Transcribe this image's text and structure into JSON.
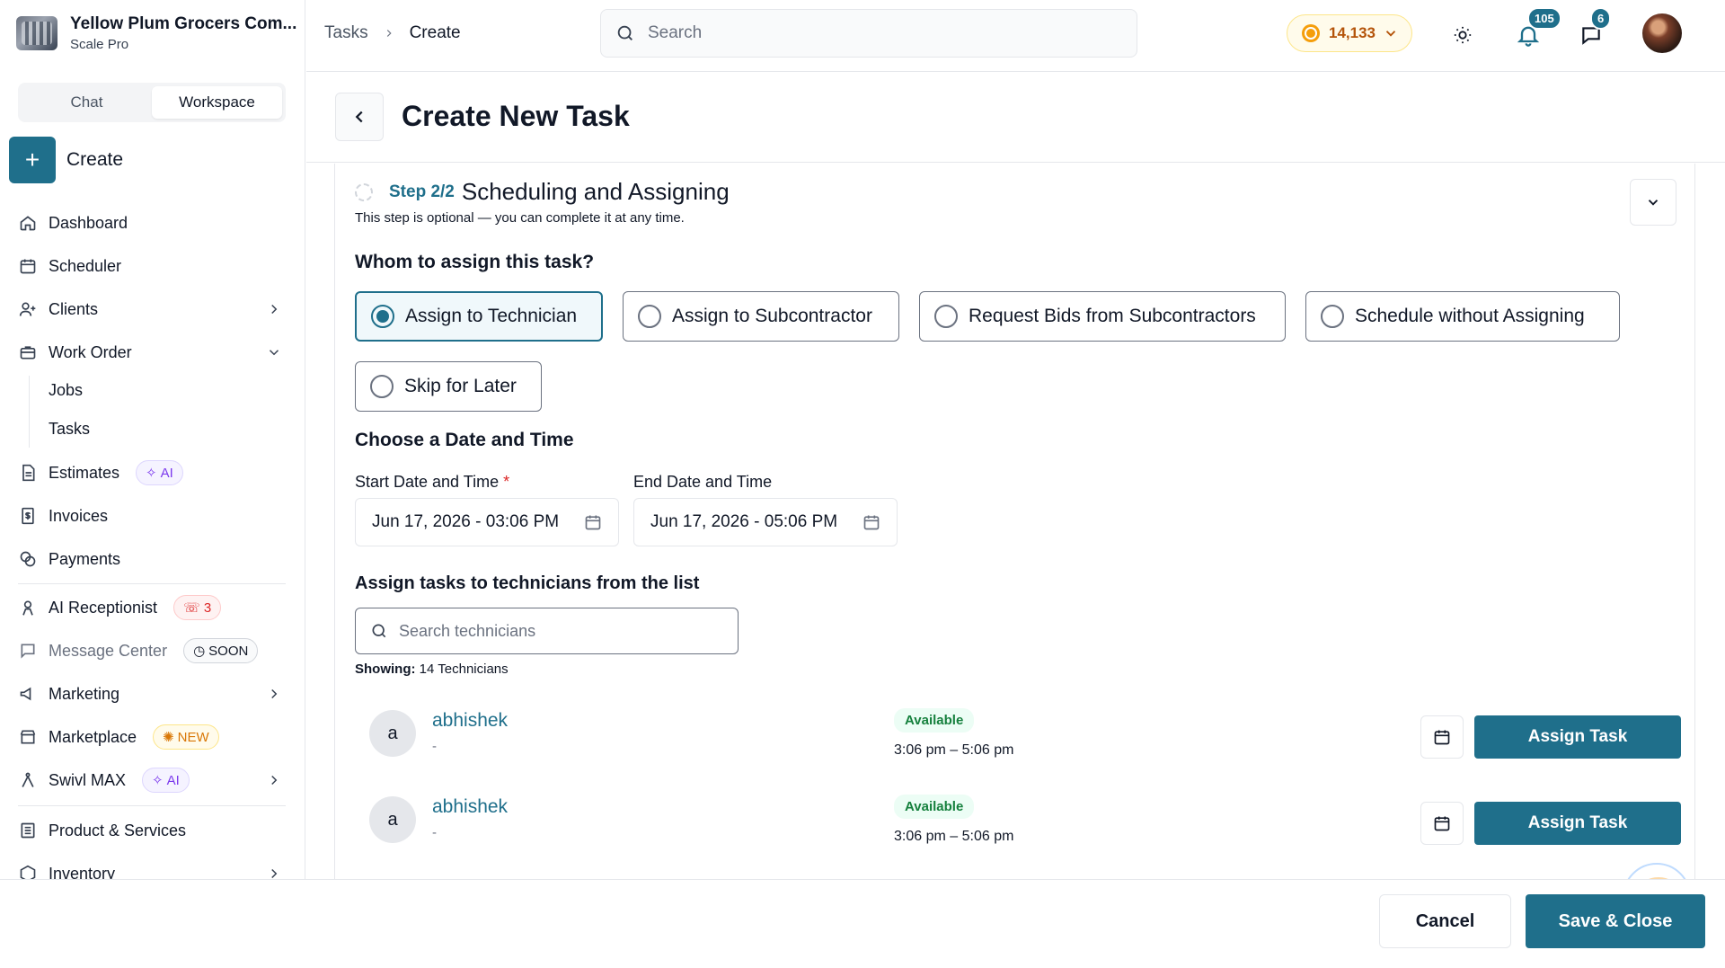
{
  "org": {
    "name": "Yellow Plum Grocers Com...",
    "plan": "Scale Pro"
  },
  "sidebar": {
    "segments": [
      {
        "label": "Chat"
      },
      {
        "label": "Workspace"
      }
    ],
    "active_segment": "Workspace",
    "create_label": "Create",
    "items": {
      "dashboard": "Dashboard",
      "scheduler": "Scheduler",
      "clients": "Clients",
      "work_order": "Work Order",
      "jobs": "Jobs",
      "tasks": "Tasks",
      "estimates": "Estimates",
      "estimates_badge": "AI",
      "invoices": "Invoices",
      "payments": "Payments",
      "ai_receptionist": "AI Receptionist",
      "ai_receptionist_badge": "3",
      "message_center": "Message Center",
      "message_center_badge": "SOON",
      "marketing": "Marketing",
      "marketplace": "Marketplace",
      "marketplace_badge": "NEW",
      "swivl_max": "Swivl MAX",
      "swivl_max_badge": "AI",
      "product_services": "Product & Services",
      "inventory": "Inventory"
    }
  },
  "topbar": {
    "breadcrumb": [
      "Tasks",
      "Create"
    ],
    "search_placeholder": "Search",
    "credits": "14,133",
    "notifications_count": "105",
    "messages_count": "6"
  },
  "page": {
    "title": "Create New Task"
  },
  "step": {
    "label": "Step 2/2",
    "title": "Scheduling and Assigning",
    "note": "This step is optional — you can complete it at any time."
  },
  "assign": {
    "heading": "Whom to assign this task?",
    "options": [
      {
        "label": "Assign to Technician",
        "selected": true
      },
      {
        "label": "Assign to Subcontractor",
        "selected": false
      },
      {
        "label": "Request Bids from Subcontractors",
        "selected": false
      },
      {
        "label": "Schedule without Assigning",
        "selected": false
      },
      {
        "label": "Skip for Later",
        "selected": false
      }
    ]
  },
  "datetime": {
    "heading": "Choose a Date and Time",
    "start_label": "Start Date and Time",
    "required_mark": "*",
    "start_value": "Jun 17, 2026 - 03:06 PM",
    "end_label": "End Date and Time",
    "end_value": "Jun 17, 2026 - 05:06 PM"
  },
  "technicians": {
    "heading": "Assign tasks to technicians from the list",
    "search_placeholder": "Search technicians",
    "showing_label": "Showing:",
    "showing_value": "14 Technicians",
    "rows": [
      {
        "initial": "a",
        "name": "abhishek",
        "sub": "-",
        "status": "Available",
        "time": "3:06 pm – 5:06 pm",
        "action": "Assign Task"
      },
      {
        "initial": "a",
        "name": "abhishek",
        "sub": "-",
        "status": "Available",
        "time": "3:06 pm – 5:06 pm",
        "action": "Assign Task"
      }
    ]
  },
  "footer": {
    "cancel": "Cancel",
    "save": "Save & Close"
  },
  "colors": {
    "primary": "#1f6f8b",
    "available": "#15803d",
    "ai": "#7c3aed",
    "alert": "#dc2626",
    "credits": "#b45309"
  }
}
